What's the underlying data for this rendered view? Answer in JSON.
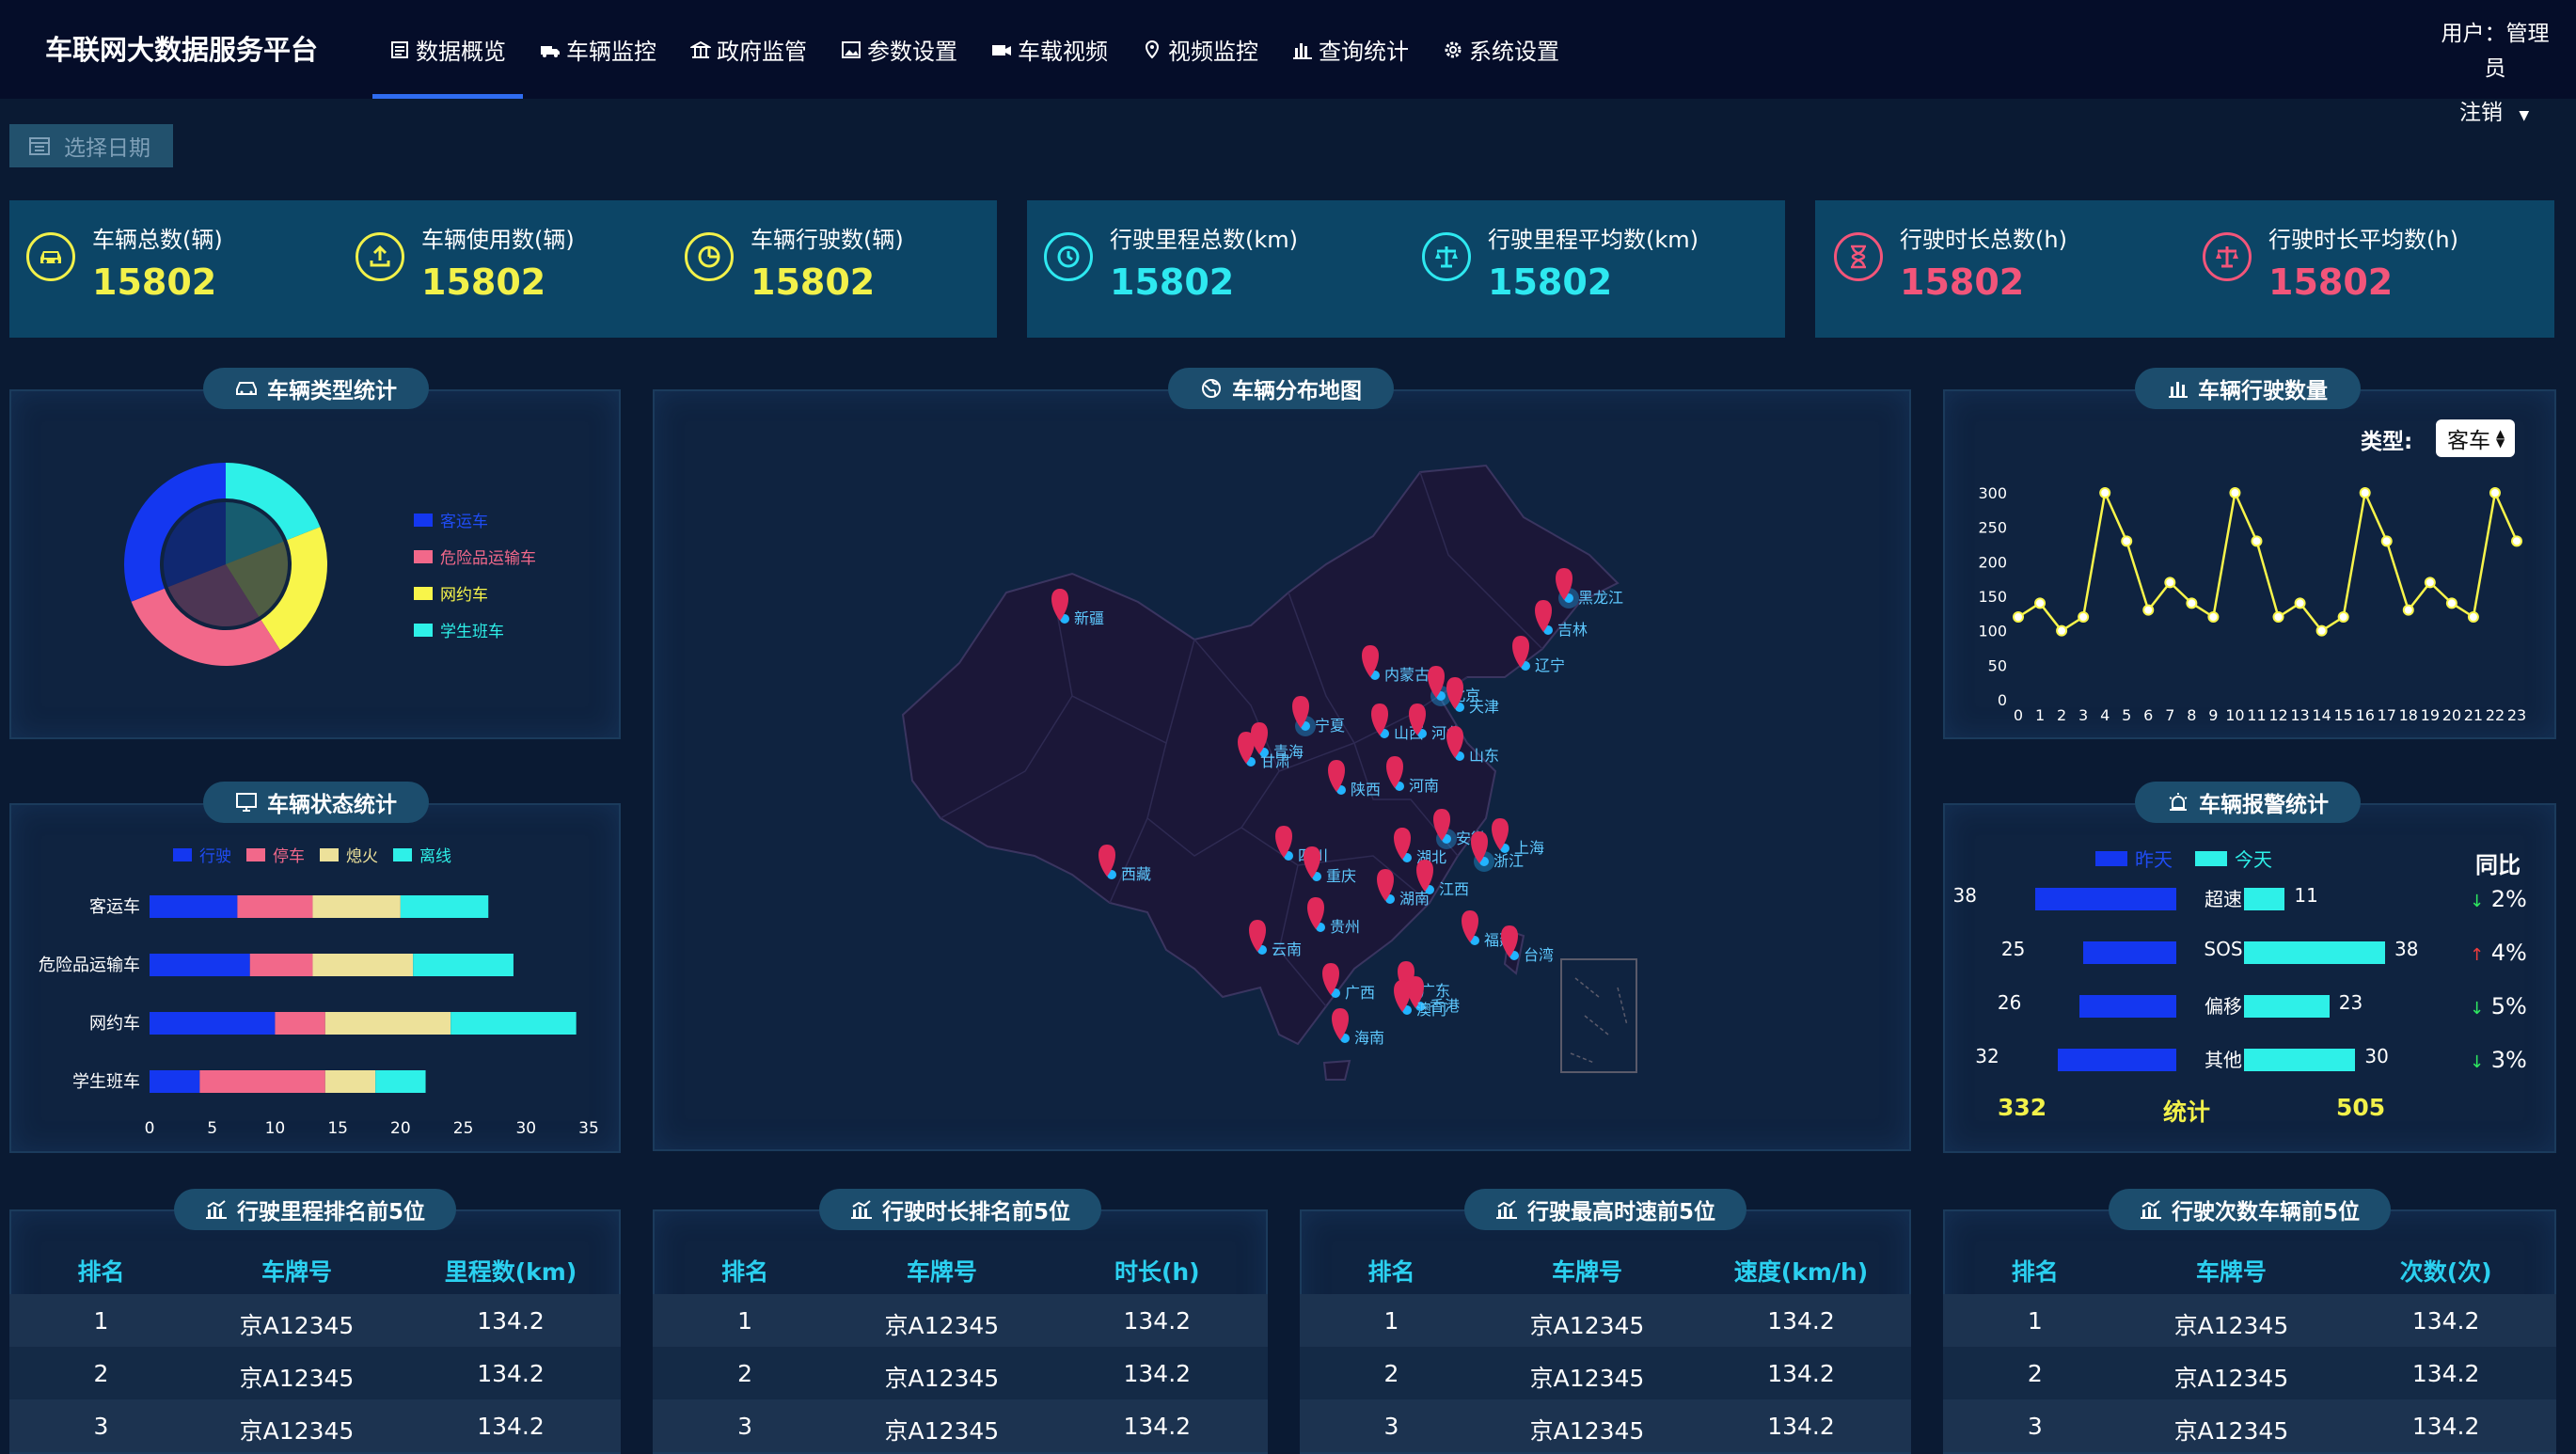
{
  "header": {
    "brand": "车联网大数据服务平台",
    "nav": [
      {
        "label": "数据概览",
        "icon": "doc-icon",
        "active": true
      },
      {
        "label": "车辆监控",
        "icon": "truck-icon"
      },
      {
        "label": "政府监管",
        "icon": "building-icon"
      },
      {
        "label": "参数设置",
        "icon": "image-icon"
      },
      {
        "label": "车载视频",
        "icon": "video-icon"
      },
      {
        "label": "视频监控",
        "icon": "location-icon"
      },
      {
        "label": "查询统计",
        "icon": "chart-bars-icon"
      },
      {
        "label": "系统设置",
        "icon": "gear-icon"
      }
    ],
    "user_line1": "用户：管理",
    "user_line2": "员",
    "logout": "注销"
  },
  "date_picker": {
    "label": "选择日期"
  },
  "stats": [
    {
      "label": "车辆总数(辆)",
      "value": "15802",
      "icon": "car-icon",
      "color": "#f2f14a"
    },
    {
      "label": "车辆使用数(辆)",
      "value": "15802",
      "icon": "upload-icon",
      "color": "#f2f14a"
    },
    {
      "label": "车辆行驶数(辆)",
      "value": "15802",
      "icon": "pie-icon",
      "color": "#f2f14a"
    },
    {
      "label": "行驶里程总数(km)",
      "value": "15802",
      "icon": "clock-icon",
      "color": "#2ee8f0"
    },
    {
      "label": "行驶里程平均数(km)",
      "value": "15802",
      "icon": "scale-icon",
      "color": "#2ee8f0"
    },
    {
      "label": "行驶时长总数(h)",
      "value": "15802",
      "icon": "hourglass-icon",
      "color": "#f2557a"
    },
    {
      "label": "行驶时长平均数(h)",
      "value": "15802",
      "icon": "scale-icon",
      "color": "#f2557a"
    }
  ],
  "panels": {
    "vehicle_type": "车辆类型统计",
    "map": "车辆分布地图",
    "driving_count": "车辆行驶数量",
    "status": "车辆状态统计",
    "alarm": "车辆报警统计",
    "rank_mileage": "行驶里程排名前5位",
    "rank_duration": "行驶时长排名前5位",
    "rank_speed": "行驶最高时速前5位",
    "rank_trips": "行驶次数车辆前5位"
  },
  "type_select": {
    "label": "类型:",
    "value": "客车"
  },
  "chart_data": [
    {
      "type": "pie",
      "legend": [
        "客运车",
        "危险品运输车",
        "网约车",
        "学生班车"
      ],
      "values": [
        31,
        28,
        22,
        19
      ],
      "colors": [
        "#1437f0",
        "#f2688a",
        "#f8f54a",
        "#2ef0e8"
      ]
    },
    {
      "type": "bar",
      "orientation": "horizontal-stacked",
      "categories": [
        "客运车",
        "危险品运输车",
        "网约车",
        "学生班车"
      ],
      "series": [
        {
          "name": "行驶",
          "values": [
            7,
            8,
            10,
            4
          ],
          "color": "#1437f0"
        },
        {
          "name": "停车",
          "values": [
            6,
            5,
            4,
            10
          ],
          "color": "#f2688a"
        },
        {
          "name": "熄火",
          "values": [
            7,
            8,
            10,
            4
          ],
          "color": "#ede19a"
        },
        {
          "name": "离线",
          "values": [
            7,
            8,
            10,
            4
          ],
          "color": "#2ef0e8"
        }
      ],
      "xticks": [
        "0",
        "5",
        "10",
        "15",
        "20",
        "25",
        "30",
        "35"
      ],
      "xlim": [
        0,
        35
      ]
    },
    {
      "type": "line",
      "x": [
        "0",
        "1",
        "2",
        "3",
        "4",
        "5",
        "6",
        "7",
        "8",
        "9",
        "10",
        "11",
        "12",
        "13",
        "14",
        "15",
        "16",
        "17",
        "18",
        "19",
        "20",
        "21",
        "22",
        "23"
      ],
      "values": [
        120,
        140,
        100,
        120,
        300,
        230,
        130,
        170,
        140,
        120,
        300,
        230,
        120,
        140,
        100,
        120,
        300,
        230,
        130,
        170,
        140,
        120,
        300,
        230
      ],
      "yticks": [
        "0",
        "50",
        "100",
        "150",
        "200",
        "250",
        "300"
      ],
      "ylim": [
        0,
        300
      ],
      "color": "#f8f54a"
    }
  ],
  "alarm": {
    "legend": [
      "昨天",
      "今天"
    ],
    "rows": [
      {
        "label": "超速",
        "yesterday": 38,
        "today": 11,
        "yoy": "2%",
        "dir": "down"
      },
      {
        "label": "SOS",
        "yesterday": 25,
        "today": 38,
        "yoy": "4%",
        "dir": "up"
      },
      {
        "label": "偏移",
        "yesterday": 26,
        "today": 23,
        "yoy": "5%",
        "dir": "down"
      },
      {
        "label": "其他",
        "yesterday": 32,
        "today": 30,
        "yoy": "3%",
        "dir": "down"
      }
    ],
    "total_label": "统计",
    "total_yesterday": "332",
    "total_today": "505",
    "yoy_title": "同比"
  },
  "map": {
    "provinces": [
      "新疆",
      "内蒙古",
      "北京",
      "天津",
      "宁夏",
      "山西",
      "河北",
      "山东",
      "甘肃",
      "青海",
      "陕西",
      "河南",
      "黑龙江",
      "吉林",
      "辽宁",
      "西藏",
      "四川",
      "重庆",
      "湖北",
      "安徽",
      "上海",
      "浙江",
      "湖南",
      "江西",
      "贵州",
      "云南",
      "福建",
      "台湾",
      "广西",
      "广东",
      "香港",
      "澳门",
      "海南"
    ]
  },
  "tables": [
    {
      "headers": [
        "排名",
        "车牌号",
        "里程数(km)"
      ],
      "rows": [
        [
          "1",
          "京A12345",
          "134.2"
        ],
        [
          "2",
          "京A12345",
          "134.2"
        ],
        [
          "3",
          "京A12345",
          "134.2"
        ]
      ]
    },
    {
      "headers": [
        "排名",
        "车牌号",
        "时长(h)"
      ],
      "rows": [
        [
          "1",
          "京A12345",
          "134.2"
        ],
        [
          "2",
          "京A12345",
          "134.2"
        ],
        [
          "3",
          "京A12345",
          "134.2"
        ]
      ]
    },
    {
      "headers": [
        "排名",
        "车牌号",
        "速度(km/h)"
      ],
      "rows": [
        [
          "1",
          "京A12345",
          "134.2"
        ],
        [
          "2",
          "京A12345",
          "134.2"
        ],
        [
          "3",
          "京A12345",
          "134.2"
        ]
      ]
    },
    {
      "headers": [
        "排名",
        "车牌号",
        "次数(次)"
      ],
      "rows": [
        [
          "1",
          "京A12345",
          "134.2"
        ],
        [
          "2",
          "京A12345",
          "134.2"
        ],
        [
          "3",
          "京A12345",
          "134.2"
        ]
      ]
    }
  ]
}
